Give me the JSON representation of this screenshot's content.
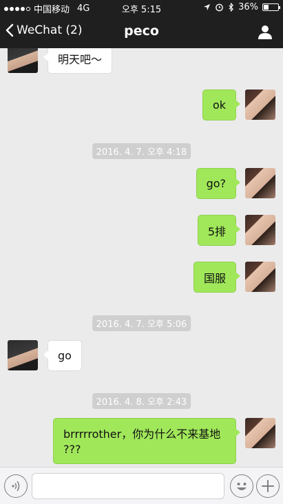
{
  "status_bar": {
    "carrier": "中国移动",
    "network": "4G",
    "time": "오후 5:15",
    "battery": "36%",
    "battery_level": 0.36
  },
  "nav": {
    "back_label": "WeChat (2)",
    "title": "peco"
  },
  "messages": [
    {
      "side": "left",
      "text": "明天吧～"
    },
    {
      "side": "right",
      "text": "ok"
    },
    {
      "side": "right",
      "text": "go?"
    },
    {
      "side": "right",
      "text": "5排"
    },
    {
      "side": "right",
      "text": "国服"
    },
    {
      "side": "left",
      "text": "go"
    },
    {
      "side": "right",
      "text": "brrrrrother，你为什么不来基地\n???"
    }
  ],
  "timestamps": [
    "2016. 4. 7. 오후 4:18",
    "2016. 4. 7. 오후 5:06",
    "2016. 4. 8. 오후 2:43"
  ],
  "input": {
    "placeholder": ""
  }
}
